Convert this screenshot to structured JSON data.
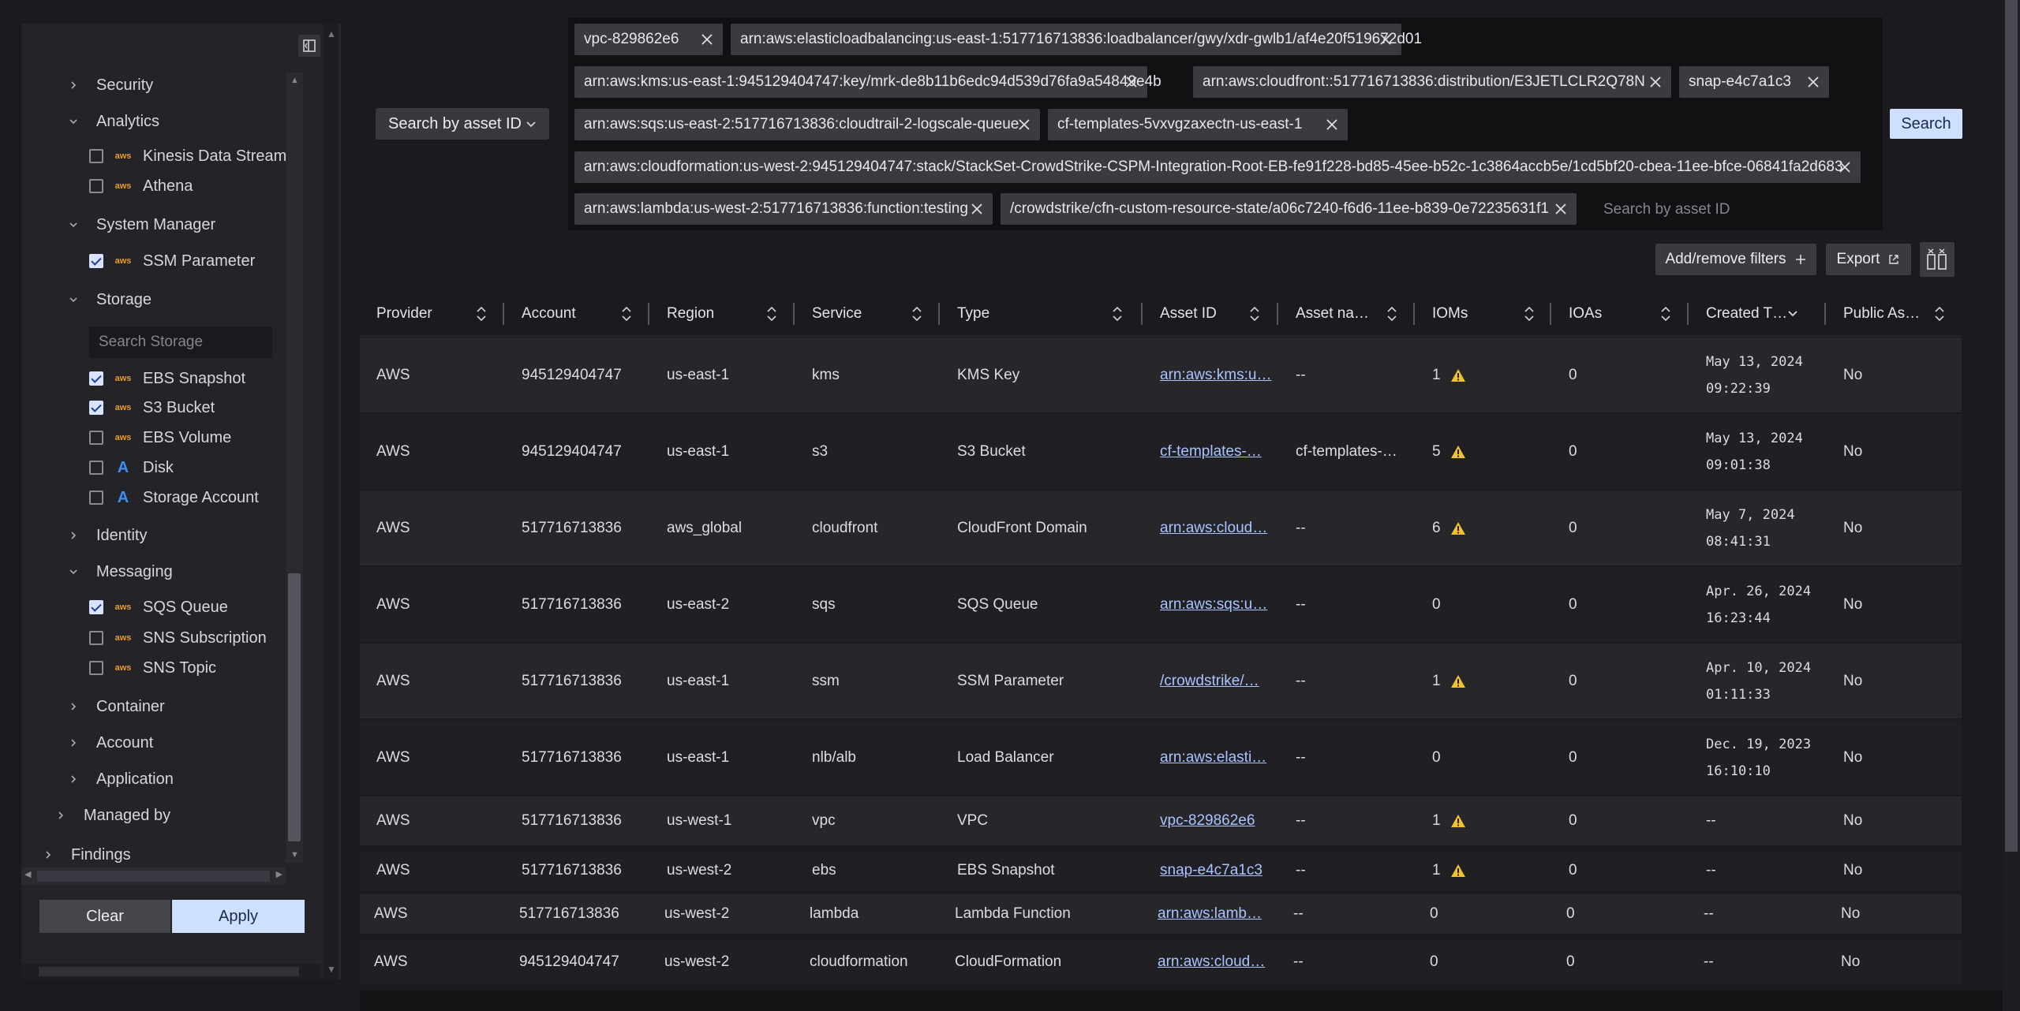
{
  "sidebar": {
    "tree": [
      {
        "label": "Security",
        "expanded": false
      },
      {
        "label": "Analytics",
        "expanded": true
      },
      {
        "label": "Kinesis Data Stream",
        "checked": false,
        "icon": "aws-icon"
      },
      {
        "label": "Athena",
        "checked": false,
        "icon": "aws-icon"
      },
      {
        "label": "System Manager",
        "expanded": true
      },
      {
        "label": "SSM Parameter",
        "checked": true,
        "icon": "aws-icon"
      },
      {
        "label": "Storage",
        "expanded": true
      },
      {
        "label": "EBS Snapshot",
        "checked": true,
        "icon": "aws-icon"
      },
      {
        "label": "S3 Bucket",
        "checked": true,
        "icon": "aws-icon"
      },
      {
        "label": "EBS Volume",
        "checked": false,
        "icon": "aws-icon"
      },
      {
        "label": "Disk",
        "checked": false,
        "icon": "azure-icon"
      },
      {
        "label": "Storage Account",
        "checked": false,
        "icon": "azure-icon"
      },
      {
        "label": "Identity",
        "expanded": false
      },
      {
        "label": "Messaging",
        "expanded": true
      },
      {
        "label": "SQS Queue",
        "checked": true,
        "icon": "aws-icon"
      },
      {
        "label": "SNS Subscription",
        "checked": false,
        "icon": "aws-icon"
      },
      {
        "label": "SNS Topic",
        "checked": false,
        "icon": "aws-icon"
      },
      {
        "label": "Container",
        "expanded": false
      },
      {
        "label": "Account",
        "expanded": false
      },
      {
        "label": "Application",
        "expanded": false
      },
      {
        "label": "Managed by",
        "expanded": false
      },
      {
        "label": "Findings",
        "expanded": false
      }
    ],
    "storage_search_placeholder": "Search Storage",
    "aws_icon_text": "aws",
    "azure_icon_text": "A",
    "clear_label": "Clear",
    "apply_label": "Apply"
  },
  "search": {
    "mode_label": "Search by asset ID",
    "placeholder": "Search by asset ID",
    "button_label": "Search",
    "chips": [
      "vpc-829862e6",
      "arn:aws:elasticloadbalancing:us-east-1:517716713836:loadbalancer/gwy/xdr-gwlb1/af4e20f519672d01",
      "arn:aws:kms:us-east-1:945129404747:key/mrk-de8b11b6edc94d539d76fa9a54849e4b",
      "arn:aws:cloudfront::517716713836:distribution/E3JETLCLR2Q78N",
      "snap-e4c7a1c3",
      "arn:aws:sqs:us-east-2:517716713836:cloudtrail-2-logscale-queue",
      "cf-templates-5vxvgzaxectn-us-east-1",
      "arn:aws:cloudformation:us-west-2:945129404747:stack/StackSet-CrowdStrike-CSPM-Integration-Root-EB-fe91f228-bd85-45ee-b52c-1c3864accb5e/1cd5bf20-cbea-11ee-bfce-06841fa2d683",
      "arn:aws:lambda:us-west-2:517716713836:function:testing",
      "/crowdstrike/cfn-custom-resource-state/a06c7240-f6d6-11ee-b839-0e72235631f1"
    ]
  },
  "toolbar": {
    "add_filters_label": "Add/remove filters",
    "export_label": "Export"
  },
  "table": {
    "columns": [
      "Provider",
      "Account",
      "Region",
      "Service",
      "Type",
      "Asset ID",
      "Asset na…",
      "IOMs",
      "IOAs",
      "Created T…",
      "Public As…"
    ],
    "rows": [
      {
        "provider": "AWS",
        "account": "945129404747",
        "region": "us-east-1",
        "service": "kms",
        "type": "KMS Key",
        "asset_id": "arn:aws:kms:u…",
        "asset_name": "--",
        "ioms": "1",
        "ioms_warn": true,
        "ioas": "0",
        "created": "May 13, 2024\n09:22:39",
        "public": "No"
      },
      {
        "provider": "AWS",
        "account": "945129404747",
        "region": "us-east-1",
        "service": "s3",
        "type": "S3 Bucket",
        "asset_id": "cf-templates-…",
        "asset_name": "cf-templates-…",
        "ioms": "5",
        "ioms_warn": true,
        "ioas": "0",
        "created": "May 13, 2024\n09:01:38",
        "public": "No"
      },
      {
        "provider": "AWS",
        "account": "517716713836",
        "region": "aws_global",
        "service": "cloudfront",
        "type": "CloudFront Domain",
        "asset_id": "arn:aws:cloud…",
        "asset_name": "--",
        "ioms": "6",
        "ioms_warn": true,
        "ioas": "0",
        "created": "May 7, 2024\n08:41:31",
        "public": "No"
      },
      {
        "provider": "AWS",
        "account": "517716713836",
        "region": "us-east-2",
        "service": "sqs",
        "type": "SQS Queue",
        "asset_id": "arn:aws:sqs:u…",
        "asset_name": "--",
        "ioms": "0",
        "ioms_warn": false,
        "ioas": "0",
        "created": "Apr. 26, 2024\n16:23:44",
        "public": "No"
      },
      {
        "provider": "AWS",
        "account": "517716713836",
        "region": "us-east-1",
        "service": "ssm",
        "type": "SSM Parameter",
        "asset_id": "/crowdstrike/…",
        "asset_name": "--",
        "ioms": "1",
        "ioms_warn": true,
        "ioas": "0",
        "created": "Apr. 10, 2024\n01:11:33",
        "public": "No"
      },
      {
        "provider": "AWS",
        "account": "517716713836",
        "region": "us-east-1",
        "service": "nlb/alb",
        "type": "Load Balancer",
        "asset_id": "arn:aws:elasti…",
        "asset_name": "--",
        "ioms": "0",
        "ioms_warn": false,
        "ioas": "0",
        "created": "Dec. 19, 2023\n16:10:10",
        "public": "No"
      },
      {
        "provider": "AWS",
        "account": "517716713836",
        "region": "us-west-1",
        "service": "vpc",
        "type": "VPC",
        "asset_id": "vpc-829862e6",
        "asset_name": "--",
        "ioms": "1",
        "ioms_warn": true,
        "ioas": "0",
        "created": "--",
        "public": "No"
      },
      {
        "provider": "AWS",
        "account": "517716713836",
        "region": "us-west-2",
        "service": "ebs",
        "type": "EBS Snapshot",
        "asset_id": "snap-e4c7a1c3",
        "asset_name": "--",
        "ioms": "1",
        "ioms_warn": true,
        "ioas": "0",
        "created": "--",
        "public": "No"
      },
      {
        "provider": "AWS",
        "account": "517716713836",
        "region": "us-west-2",
        "service": "lambda",
        "type": "Lambda Function",
        "asset_id": "arn:aws:lamb…",
        "asset_name": "--",
        "ioms": "0",
        "ioms_warn": false,
        "ioas": "0",
        "created": "--",
        "public": "No"
      },
      {
        "provider": "AWS",
        "account": "945129404747",
        "region": "us-west-2",
        "service": "cloudformation",
        "type": "CloudFormation",
        "asset_id": "arn:aws:cloud…",
        "asset_name": "--",
        "ioms": "0",
        "ioms_warn": false,
        "ioas": "0",
        "created": "--",
        "public": "No"
      }
    ]
  },
  "colors": {
    "accent": "#cfe0ff",
    "warning": "#f2c12e",
    "link": "#a9c4ff"
  }
}
